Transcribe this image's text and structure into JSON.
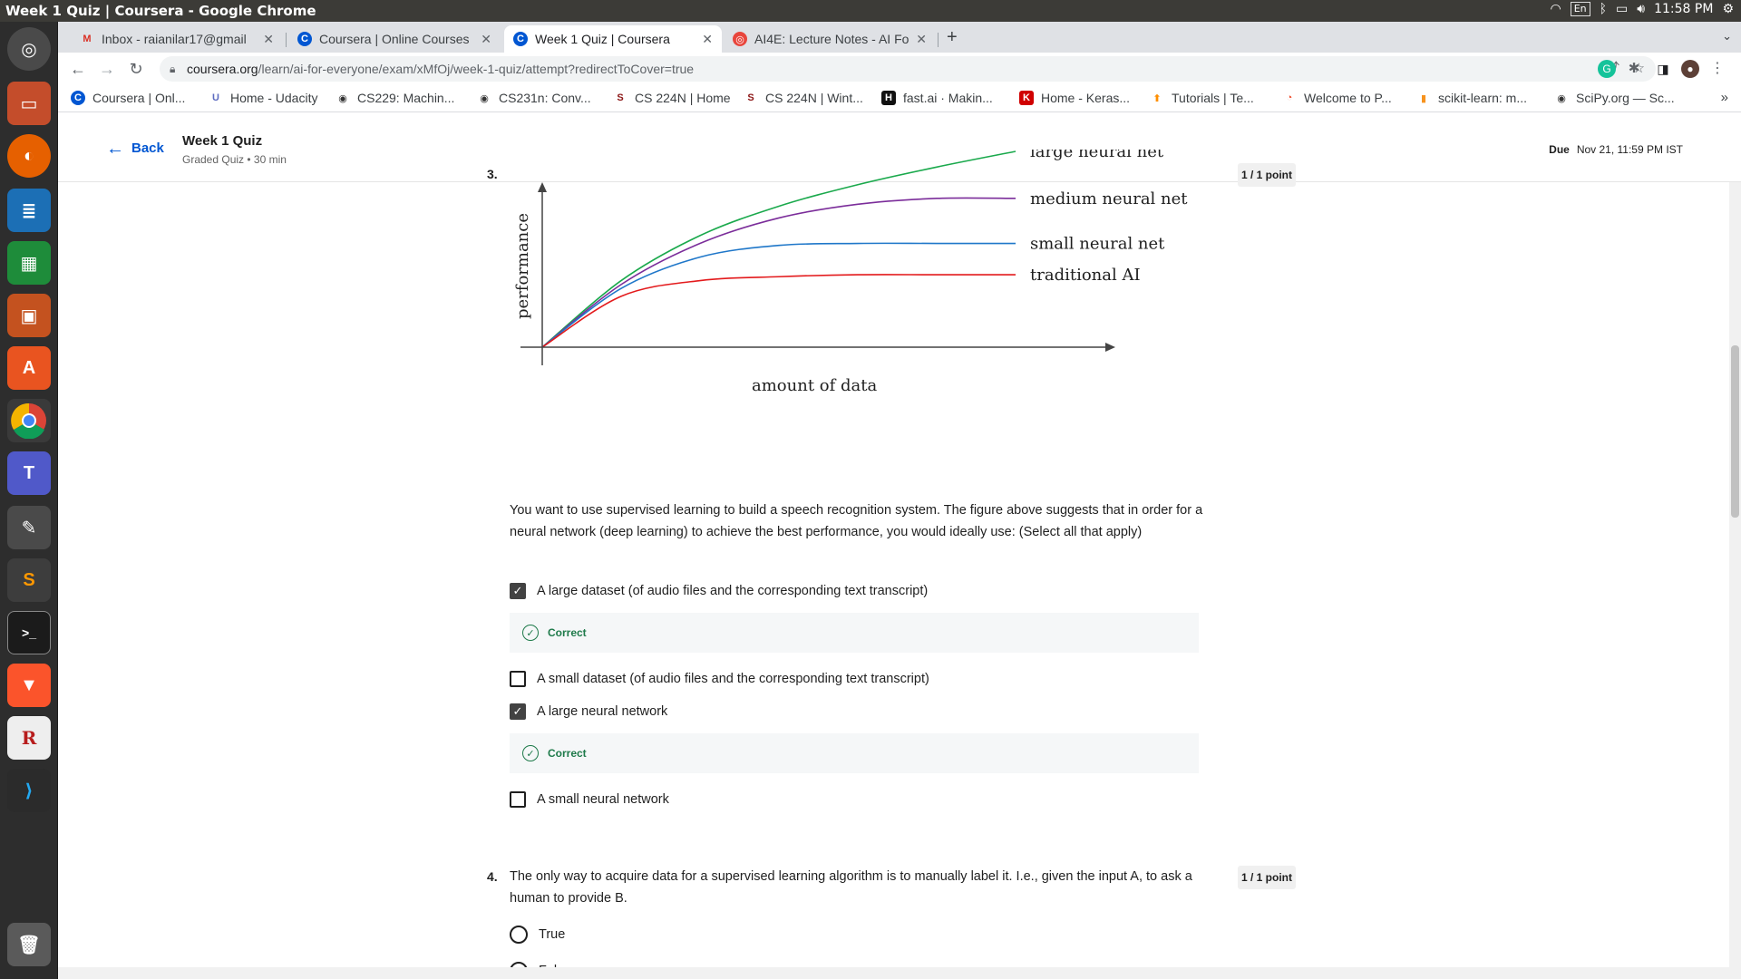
{
  "os": {
    "window_title": "Week 1 Quiz | Coursera - Google Chrome",
    "lang": "En",
    "time": "11:58 PM"
  },
  "tabs": [
    {
      "label": "Inbox - raianilar17@gmail",
      "icon": "gmail-icon",
      "color": "#d93025"
    },
    {
      "label": "Coursera | Online Courses",
      "icon": "coursera-icon",
      "color": "#0056d2"
    },
    {
      "label": "Week 1 Quiz | Coursera",
      "icon": "coursera-icon",
      "color": "#0056d2"
    },
    {
      "label": "AI4E: Lecture Notes - AI Fo",
      "icon": "notes-icon",
      "color": "#e8453c"
    }
  ],
  "address": {
    "host": "coursera.org",
    "path": "/learn/ai-for-everyone/exam/xMfOj/week-1-quiz/attempt?redirectToCover=true"
  },
  "bookmarks": [
    {
      "label": "Coursera | Onl...",
      "icon": "C",
      "color": "#0056d2"
    },
    {
      "label": "Home - Udacity",
      "icon": "U",
      "color": "#5c6bc0"
    },
    {
      "label": "CS229: Machin...",
      "icon": "◉",
      "color": "#333333"
    },
    {
      "label": "CS231n: Conv...",
      "icon": "◉",
      "color": "#333333"
    },
    {
      "label": "CS 224N | Home",
      "icon": "S",
      "color": "#8c1515"
    },
    {
      "label": "CS 224N | Wint...",
      "icon": "S",
      "color": "#8c1515"
    },
    {
      "label": "fast.ai · Makin...",
      "icon": "H",
      "color": "#111111"
    },
    {
      "label": "Home - Keras...",
      "icon": "K",
      "color": "#d00000"
    },
    {
      "label": "Tutorials  |  Te...",
      "icon": "⬆",
      "color": "#ff8f00"
    },
    {
      "label": "Welcome to P...",
      "icon": "◔",
      "color": "#ee4c2c"
    },
    {
      "label": "scikit-learn: m...",
      "icon": "▮",
      "color": "#f7931e"
    },
    {
      "label": "SciPy.org — Sc...",
      "icon": "◉",
      "color": "#333333"
    }
  ],
  "header": {
    "back": "Back",
    "title": "Week 1 Quiz",
    "subtitle": "Graded Quiz • 30 min",
    "due_label": "Due",
    "due_value": "Nov 21, 11:59 PM IST"
  },
  "q3": {
    "number": "3.",
    "points": "1 / 1 point",
    "text": "You want to use supervised learning to build a speech recognition system. The figure above suggests that in order for a neural network (deep learning) to achieve the best performance, you would ideally use: (Select all that apply)",
    "options": [
      {
        "label": "A large dataset (of audio files and the corresponding text transcript)",
        "checked": true,
        "feedback": "Correct"
      },
      {
        "label": "A small dataset (of audio files and the corresponding text transcript)",
        "checked": false
      },
      {
        "label": "A large neural network",
        "checked": true,
        "feedback": "Correct"
      },
      {
        "label": "A small neural network",
        "checked": false
      }
    ]
  },
  "q4": {
    "number": "4.",
    "points": "1 / 1 point",
    "text": "The only way to acquire data for a supervised learning algorithm is to manually label it. I.e., given the input A, to ask a human to provide B.",
    "options": [
      {
        "label": "True"
      },
      {
        "label": "False"
      }
    ]
  },
  "chart_data": {
    "type": "line",
    "title": "",
    "xlabel": "amount of data",
    "ylabel": "performance",
    "axis_ticks": false,
    "grid": false,
    "legend": "inline-right",
    "series": [
      {
        "name": "large neural net",
        "color": "#1aa94c",
        "values": [
          0,
          0.34,
          0.57,
          0.72,
          0.83,
          0.92,
          1.0
        ]
      },
      {
        "name": "medium neural net",
        "color": "#7b2d9a",
        "values": [
          0,
          0.32,
          0.53,
          0.66,
          0.73,
          0.76,
          0.76
        ]
      },
      {
        "name": "small neural net",
        "color": "#1f77c9",
        "values": [
          0,
          0.3,
          0.46,
          0.52,
          0.53,
          0.53,
          0.53
        ]
      },
      {
        "name": "traditional AI",
        "color": "#e31a1c",
        "values": [
          0,
          0.26,
          0.34,
          0.36,
          0.37,
          0.37,
          0.37
        ]
      }
    ],
    "x": [
      0,
      1,
      2,
      3,
      4,
      5,
      6
    ]
  }
}
